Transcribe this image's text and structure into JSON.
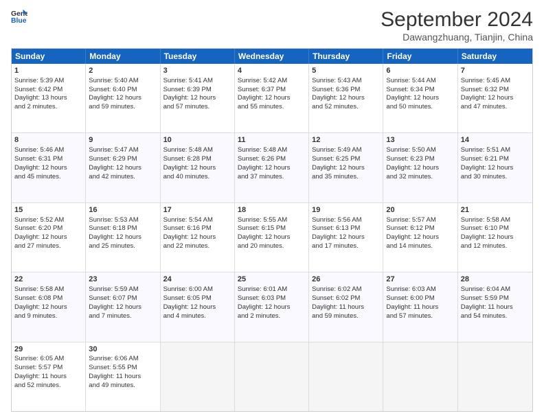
{
  "logo": {
    "line1": "General",
    "line2": "Blue"
  },
  "header": {
    "month_year": "September 2024",
    "location": "Dawangzhuang, Tianjin, China"
  },
  "days_of_week": [
    "Sunday",
    "Monday",
    "Tuesday",
    "Wednesday",
    "Thursday",
    "Friday",
    "Saturday"
  ],
  "weeks": [
    [
      {
        "day": "1",
        "info": "Sunrise: 5:39 AM\nSunset: 6:42 PM\nDaylight: 13 hours\nand 2 minutes."
      },
      {
        "day": "2",
        "info": "Sunrise: 5:40 AM\nSunset: 6:40 PM\nDaylight: 12 hours\nand 59 minutes."
      },
      {
        "day": "3",
        "info": "Sunrise: 5:41 AM\nSunset: 6:39 PM\nDaylight: 12 hours\nand 57 minutes."
      },
      {
        "day": "4",
        "info": "Sunrise: 5:42 AM\nSunset: 6:37 PM\nDaylight: 12 hours\nand 55 minutes."
      },
      {
        "day": "5",
        "info": "Sunrise: 5:43 AM\nSunset: 6:36 PM\nDaylight: 12 hours\nand 52 minutes."
      },
      {
        "day": "6",
        "info": "Sunrise: 5:44 AM\nSunset: 6:34 PM\nDaylight: 12 hours\nand 50 minutes."
      },
      {
        "day": "7",
        "info": "Sunrise: 5:45 AM\nSunset: 6:32 PM\nDaylight: 12 hours\nand 47 minutes."
      }
    ],
    [
      {
        "day": "8",
        "info": "Sunrise: 5:46 AM\nSunset: 6:31 PM\nDaylight: 12 hours\nand 45 minutes."
      },
      {
        "day": "9",
        "info": "Sunrise: 5:47 AM\nSunset: 6:29 PM\nDaylight: 12 hours\nand 42 minutes."
      },
      {
        "day": "10",
        "info": "Sunrise: 5:48 AM\nSunset: 6:28 PM\nDaylight: 12 hours\nand 40 minutes."
      },
      {
        "day": "11",
        "info": "Sunrise: 5:48 AM\nSunset: 6:26 PM\nDaylight: 12 hours\nand 37 minutes."
      },
      {
        "day": "12",
        "info": "Sunrise: 5:49 AM\nSunset: 6:25 PM\nDaylight: 12 hours\nand 35 minutes."
      },
      {
        "day": "13",
        "info": "Sunrise: 5:50 AM\nSunset: 6:23 PM\nDaylight: 12 hours\nand 32 minutes."
      },
      {
        "day": "14",
        "info": "Sunrise: 5:51 AM\nSunset: 6:21 PM\nDaylight: 12 hours\nand 30 minutes."
      }
    ],
    [
      {
        "day": "15",
        "info": "Sunrise: 5:52 AM\nSunset: 6:20 PM\nDaylight: 12 hours\nand 27 minutes."
      },
      {
        "day": "16",
        "info": "Sunrise: 5:53 AM\nSunset: 6:18 PM\nDaylight: 12 hours\nand 25 minutes."
      },
      {
        "day": "17",
        "info": "Sunrise: 5:54 AM\nSunset: 6:16 PM\nDaylight: 12 hours\nand 22 minutes."
      },
      {
        "day": "18",
        "info": "Sunrise: 5:55 AM\nSunset: 6:15 PM\nDaylight: 12 hours\nand 20 minutes."
      },
      {
        "day": "19",
        "info": "Sunrise: 5:56 AM\nSunset: 6:13 PM\nDaylight: 12 hours\nand 17 minutes."
      },
      {
        "day": "20",
        "info": "Sunrise: 5:57 AM\nSunset: 6:12 PM\nDaylight: 12 hours\nand 14 minutes."
      },
      {
        "day": "21",
        "info": "Sunrise: 5:58 AM\nSunset: 6:10 PM\nDaylight: 12 hours\nand 12 minutes."
      }
    ],
    [
      {
        "day": "22",
        "info": "Sunrise: 5:58 AM\nSunset: 6:08 PM\nDaylight: 12 hours\nand 9 minutes."
      },
      {
        "day": "23",
        "info": "Sunrise: 5:59 AM\nSunset: 6:07 PM\nDaylight: 12 hours\nand 7 minutes."
      },
      {
        "day": "24",
        "info": "Sunrise: 6:00 AM\nSunset: 6:05 PM\nDaylight: 12 hours\nand 4 minutes."
      },
      {
        "day": "25",
        "info": "Sunrise: 6:01 AM\nSunset: 6:03 PM\nDaylight: 12 hours\nand 2 minutes."
      },
      {
        "day": "26",
        "info": "Sunrise: 6:02 AM\nSunset: 6:02 PM\nDaylight: 11 hours\nand 59 minutes."
      },
      {
        "day": "27",
        "info": "Sunrise: 6:03 AM\nSunset: 6:00 PM\nDaylight: 11 hours\nand 57 minutes."
      },
      {
        "day": "28",
        "info": "Sunrise: 6:04 AM\nSunset: 5:59 PM\nDaylight: 11 hours\nand 54 minutes."
      }
    ],
    [
      {
        "day": "29",
        "info": "Sunrise: 6:05 AM\nSunset: 5:57 PM\nDaylight: 11 hours\nand 52 minutes."
      },
      {
        "day": "30",
        "info": "Sunrise: 6:06 AM\nSunset: 5:55 PM\nDaylight: 11 hours\nand 49 minutes."
      },
      {
        "day": "",
        "info": ""
      },
      {
        "day": "",
        "info": ""
      },
      {
        "day": "",
        "info": ""
      },
      {
        "day": "",
        "info": ""
      },
      {
        "day": "",
        "info": ""
      }
    ]
  ]
}
